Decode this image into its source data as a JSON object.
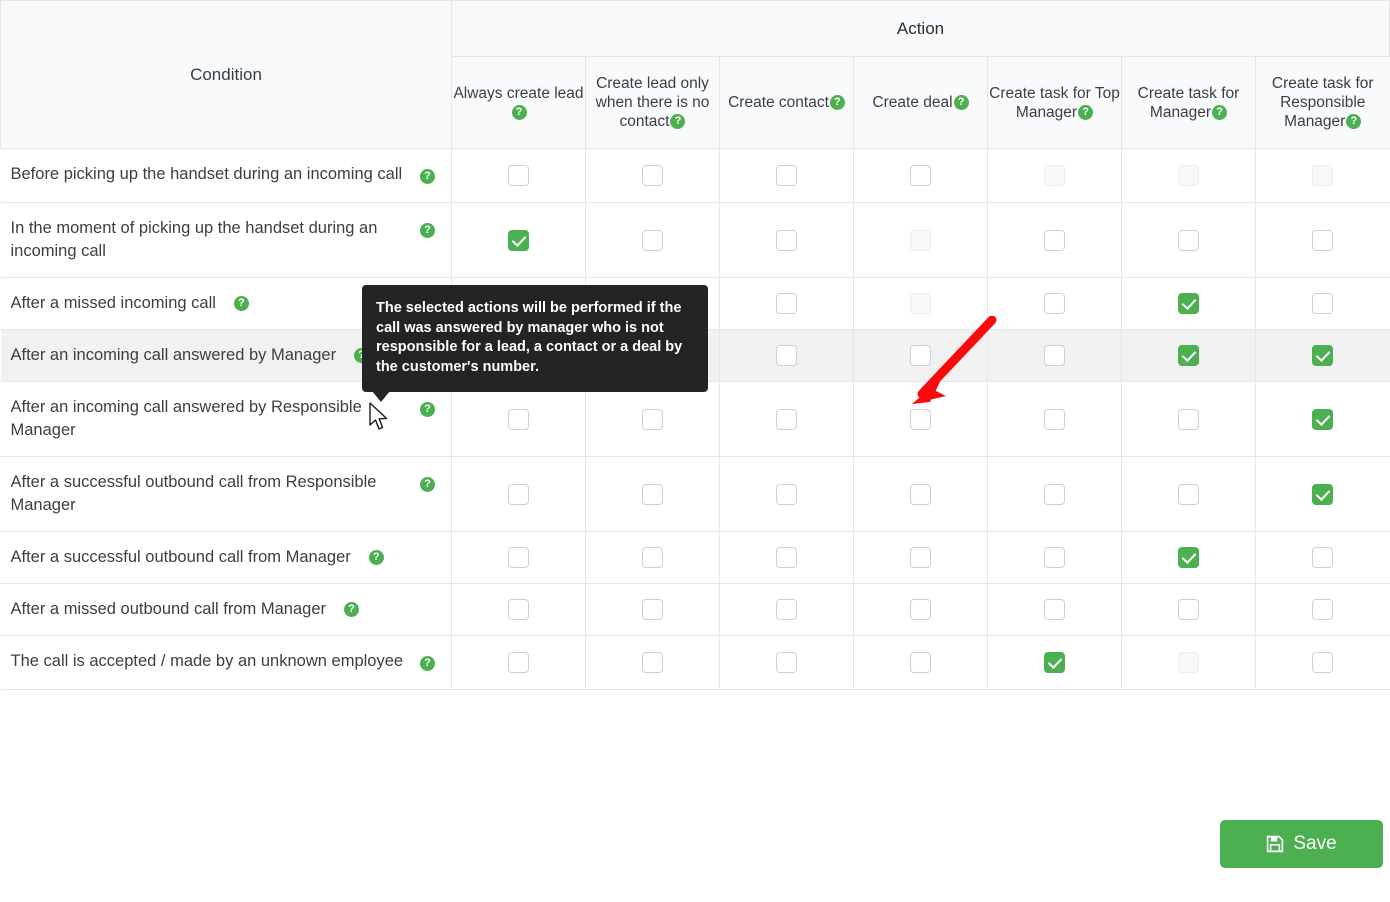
{
  "table": {
    "condition_header": "Condition",
    "action_header": "Action",
    "help_glyph": "?",
    "columns": [
      {
        "label": "Always create lead",
        "help": true
      },
      {
        "label": "Create lead only when there is no contact",
        "help": true
      },
      {
        "label": "Create contact",
        "help": true
      },
      {
        "label": "Create deal",
        "help": true
      },
      {
        "label": "Create task for Top Manager",
        "help": true
      },
      {
        "label": "Create task for Manager",
        "help": true
      },
      {
        "label": "Create task for Responsible Manager",
        "help": true
      }
    ],
    "rows": [
      {
        "label": "Before picking up the handset during an incoming call",
        "inline_help": false,
        "hovered": false,
        "cells": [
          {
            "state": "unchecked"
          },
          {
            "state": "unchecked"
          },
          {
            "state": "unchecked"
          },
          {
            "state": "unchecked"
          },
          {
            "state": "disabled"
          },
          {
            "state": "disabled"
          },
          {
            "state": "disabled"
          }
        ]
      },
      {
        "label": "In the moment of picking up the handset during an incoming call",
        "inline_help": false,
        "hovered": false,
        "cells": [
          {
            "state": "checked"
          },
          {
            "state": "unchecked"
          },
          {
            "state": "unchecked"
          },
          {
            "state": "disabled"
          },
          {
            "state": "unchecked"
          },
          {
            "state": "unchecked"
          },
          {
            "state": "unchecked"
          }
        ]
      },
      {
        "label": "After a missed incoming call",
        "inline_help": true,
        "hovered": false,
        "cells": [
          {
            "state": "unchecked"
          },
          {
            "state": "unchecked"
          },
          {
            "state": "unchecked"
          },
          {
            "state": "disabled"
          },
          {
            "state": "unchecked"
          },
          {
            "state": "checked"
          },
          {
            "state": "unchecked"
          }
        ]
      },
      {
        "label": "After an incoming call answered by Manager",
        "inline_help": true,
        "hovered": true,
        "cells": [
          {
            "state": "unchecked"
          },
          {
            "state": "unchecked"
          },
          {
            "state": "unchecked"
          },
          {
            "state": "unchecked"
          },
          {
            "state": "unchecked"
          },
          {
            "state": "checked"
          },
          {
            "state": "checked"
          }
        ]
      },
      {
        "label": "After an incoming call answered by Responsible Manager",
        "inline_help": false,
        "hovered": false,
        "cells": [
          {
            "state": "unchecked"
          },
          {
            "state": "unchecked"
          },
          {
            "state": "unchecked"
          },
          {
            "state": "unchecked"
          },
          {
            "state": "unchecked"
          },
          {
            "state": "unchecked"
          },
          {
            "state": "checked"
          }
        ]
      },
      {
        "label": "After a successful outbound call from Responsible Manager",
        "inline_help": false,
        "hovered": false,
        "cells": [
          {
            "state": "unchecked"
          },
          {
            "state": "unchecked"
          },
          {
            "state": "unchecked"
          },
          {
            "state": "unchecked"
          },
          {
            "state": "unchecked"
          },
          {
            "state": "unchecked"
          },
          {
            "state": "checked"
          }
        ]
      },
      {
        "label": "After a successful outbound call from Manager",
        "inline_help": true,
        "hovered": false,
        "cells": [
          {
            "state": "unchecked"
          },
          {
            "state": "unchecked"
          },
          {
            "state": "unchecked"
          },
          {
            "state": "unchecked"
          },
          {
            "state": "unchecked"
          },
          {
            "state": "checked"
          },
          {
            "state": "unchecked"
          }
        ]
      },
      {
        "label": "After a missed outbound call from Manager",
        "inline_help": true,
        "hovered": false,
        "cells": [
          {
            "state": "unchecked"
          },
          {
            "state": "unchecked"
          },
          {
            "state": "unchecked"
          },
          {
            "state": "unchecked"
          },
          {
            "state": "unchecked"
          },
          {
            "state": "unchecked"
          },
          {
            "state": "unchecked"
          }
        ]
      },
      {
        "label": "The call is accepted / made by an unknown employee",
        "inline_help": false,
        "hovered": false,
        "cells": [
          {
            "state": "unchecked"
          },
          {
            "state": "unchecked"
          },
          {
            "state": "unchecked"
          },
          {
            "state": "unchecked"
          },
          {
            "state": "checked"
          },
          {
            "state": "disabled"
          },
          {
            "state": "unchecked"
          }
        ]
      }
    ]
  },
  "tooltip": {
    "text": "The selected actions will be performed if the call was answered by manager who is not responsible for a lead, a contact or a deal by the customer's number."
  },
  "footer": {
    "save_label": "Save",
    "save_icon": "floppy-disk-icon"
  },
  "colors": {
    "accent_green": "#4caf50",
    "tooltip_bg": "#222426",
    "annotation_red": "#fa0a0a",
    "header_bg": "#f9fafb",
    "row_hover_bg": "#f1f1f1"
  }
}
